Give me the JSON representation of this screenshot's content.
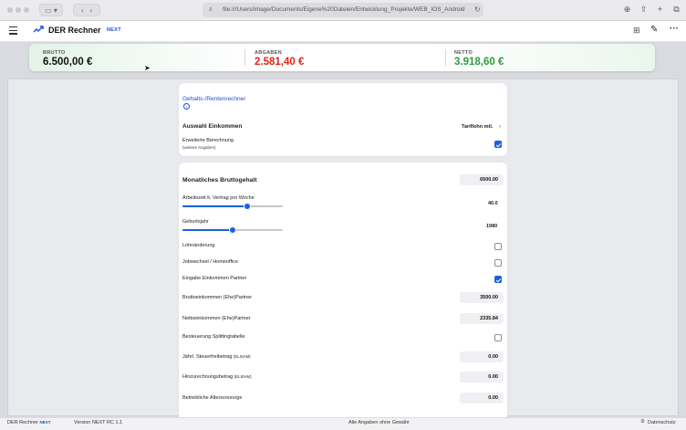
{
  "browser": {
    "url": "file:///Users/image/Documents/Eigene%20Dateien/Entwicklung_Projekte/WEB_IOS_Android"
  },
  "header": {
    "title": "DER Rechner",
    "badge": "NEXT"
  },
  "summary": {
    "brutto_label": "BRUTTO",
    "brutto_value": "6.500,00 €",
    "abgaben_label": "ABGABEN",
    "abgaben_value": "2.581,40 €",
    "netto_label": "NETTO",
    "netto_value": "3.918,60 €"
  },
  "card1": {
    "link": "Gehalts-/Rentenrechner",
    "section_title": "Auswahl Einkommen",
    "section_value": "Tariflohn mtl.",
    "extended_label": "Erweiterte Berechnung",
    "extended_sub": "(weitere Angaben)"
  },
  "card2": {
    "title": "Monatliches Bruttogehalt",
    "title_value": "6500.00",
    "hours_label": "Arbeitszeit lt. Vertrag pro Woche",
    "hours_value": "40.0",
    "birth_label": "Geburtsjahr",
    "birth_value": "1980",
    "rows": [
      {
        "label": "Lohnänderung"
      },
      {
        "label": "Jobwechsel / Homeoffice"
      },
      {
        "label": "Eingabe Einkommen Partner"
      },
      {
        "label": "Bruttoeinkommen (Ehe)Partner",
        "value": "3500.00"
      },
      {
        "label": "Nettoeinkommen (Ehe)Partner",
        "value": "2335.84"
      },
      {
        "label": "Besteuerung Splittingtabelle"
      },
      {
        "label": "Jährl. Steuerfreibetrag",
        "suffix": "(ELStAM)",
        "value": "0.00"
      },
      {
        "label": "Hinzurechnungsbetrag",
        "suffix": "(ELStAM)",
        "value": "0.00"
      },
      {
        "label": "Betriebliche Altersvorsorge",
        "value": "0.00"
      }
    ]
  },
  "footer": {
    "app": "DER Rechner",
    "app_badge": "NEXT",
    "version": "Version NEXT RC 1.1",
    "disclaimer": "Alle Angaben ohne Gewähr",
    "privacy": "Datenschutz"
  },
  "colors": {
    "accent": "#1a5fe0",
    "brutto": "#111111",
    "abgaben": "#e0241b",
    "netto": "#2e9a3e"
  }
}
